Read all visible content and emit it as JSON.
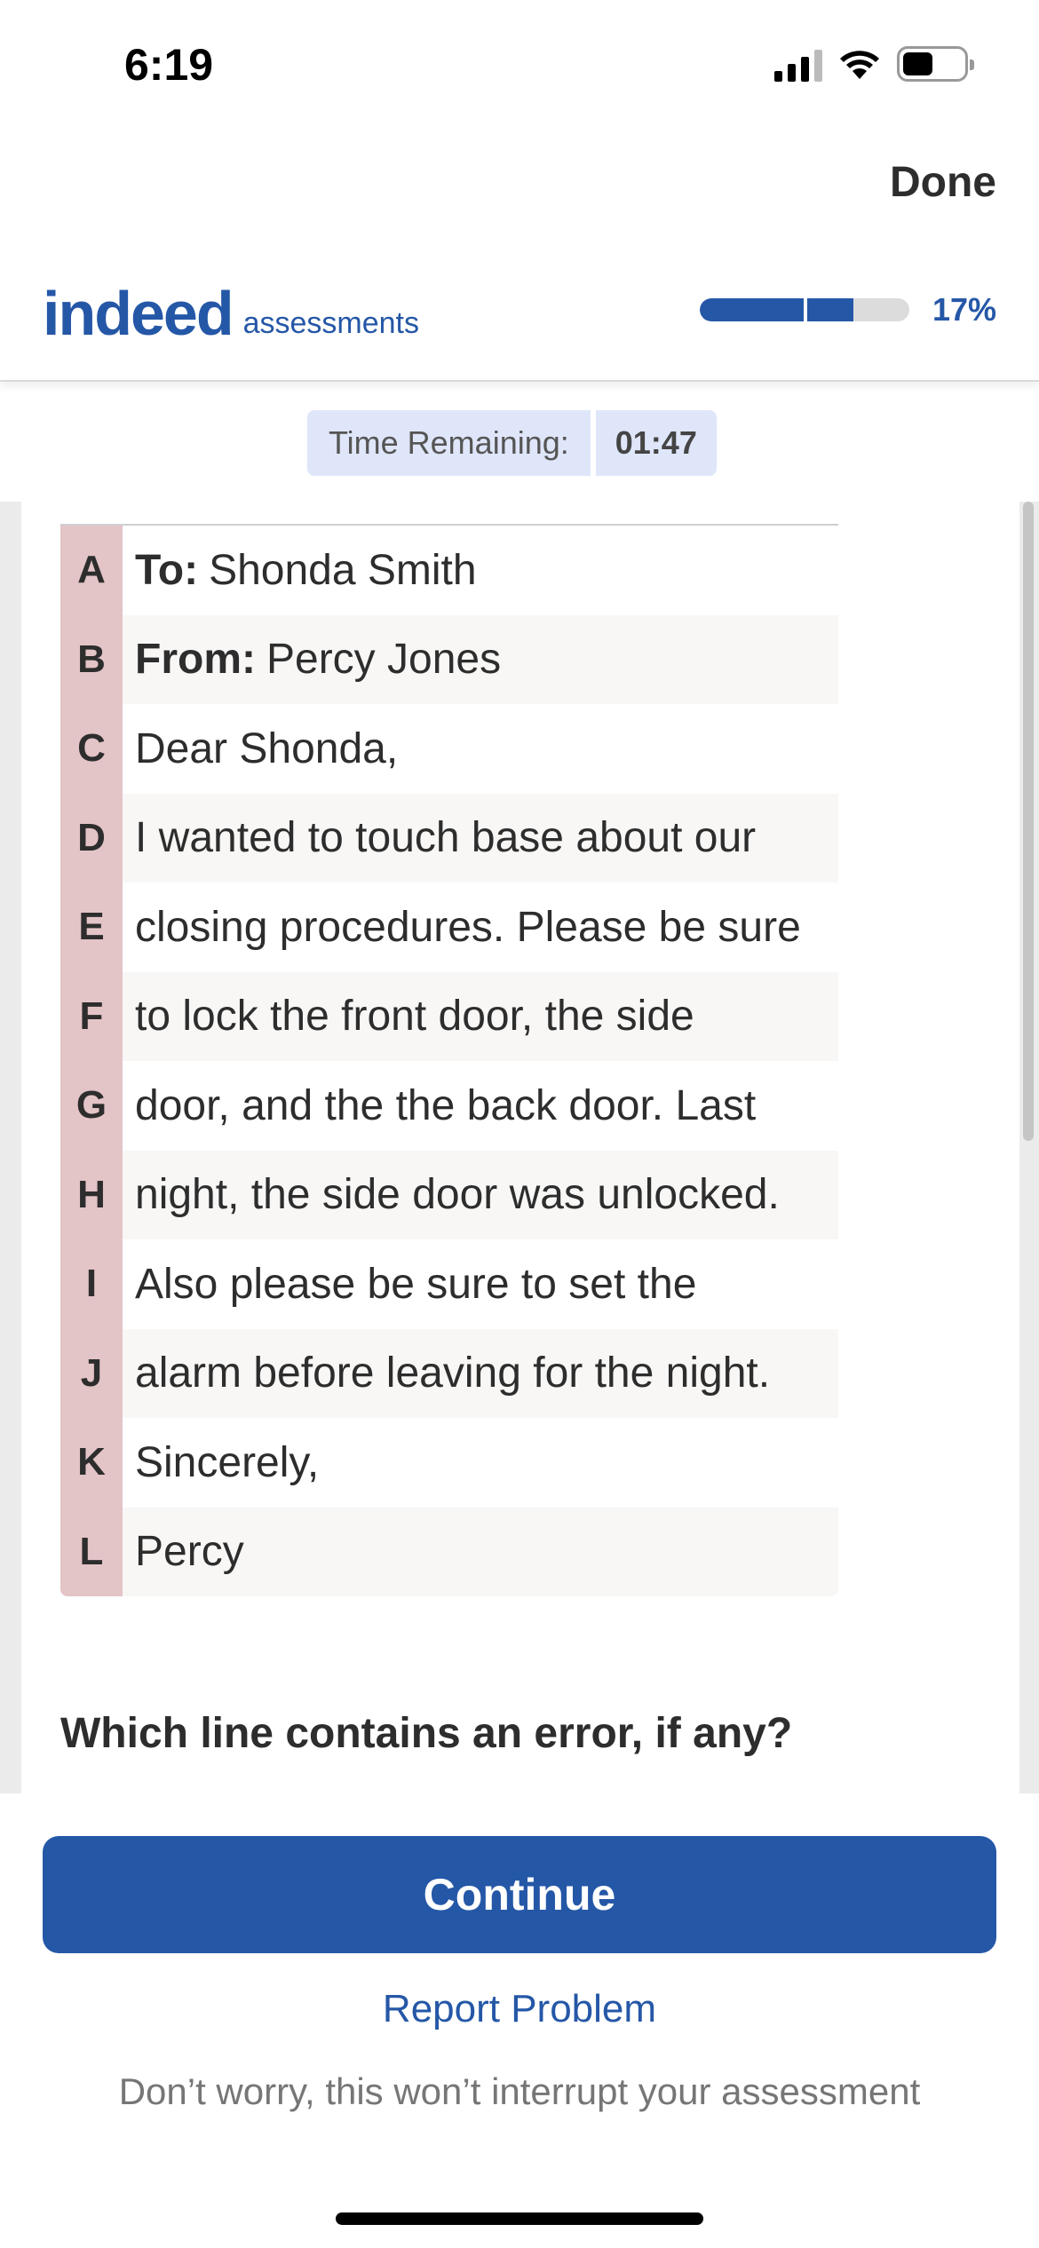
{
  "status_bar": {
    "time": "6:19"
  },
  "nav": {
    "done_label": "Done"
  },
  "header": {
    "logo_word": "indeed",
    "logo_suffix": "assessments",
    "progress_percent": 17,
    "progress_label": "17%",
    "brand_color": "#2557a7"
  },
  "timer": {
    "label": "Time Remaining:",
    "value": "01:47"
  },
  "letter_lines": [
    {
      "letter": "A",
      "bold": "To:",
      "text": "Shonda Smith"
    },
    {
      "letter": "B",
      "bold": "From:",
      "text": "Percy Jones"
    },
    {
      "letter": "C",
      "bold": "",
      "text": "Dear Shonda,"
    },
    {
      "letter": "D",
      "bold": "",
      "text": "I wanted to touch base about our"
    },
    {
      "letter": "E",
      "bold": "",
      "text": "closing procedures. Please be sure"
    },
    {
      "letter": "F",
      "bold": "",
      "text": "to lock the front door, the side"
    },
    {
      "letter": "G",
      "bold": "",
      "text": "door, and the the back door. Last"
    },
    {
      "letter": "H",
      "bold": "",
      "text": "night, the side door was unlocked."
    },
    {
      "letter": "I",
      "bold": "",
      "text": "Also please be sure to set the"
    },
    {
      "letter": "J",
      "bold": "",
      "text": "alarm before leaving for the night."
    },
    {
      "letter": "K",
      "bold": "",
      "text": "Sincerely,"
    },
    {
      "letter": "L",
      "bold": "",
      "text": "Percy"
    }
  ],
  "question": "Which line contains an error, if any?",
  "footer": {
    "continue_label": "Continue",
    "report_label": "Report Problem",
    "reassure_text": "Don’t worry, this won’t interrupt your assessment"
  }
}
